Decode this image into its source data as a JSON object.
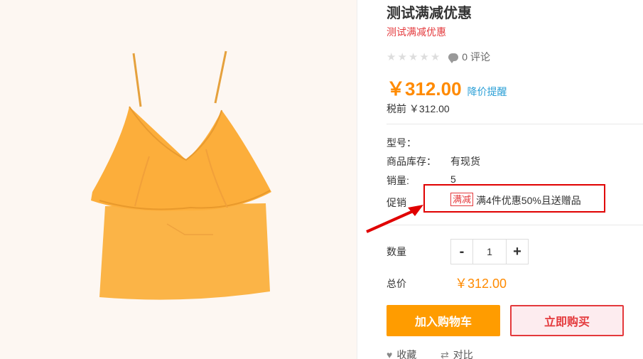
{
  "product": {
    "title": "测试满减优惠",
    "subtitle": "测试满减优惠",
    "rating_stars": 0,
    "comments_label": "0 评论",
    "price": "￥312.00",
    "price_alert": "降价提醒",
    "tax_label": "税前",
    "tax_price": "￥312.00"
  },
  "attributes": {
    "model_label": "型号：",
    "model_value": "",
    "stock_label": "商品库存：",
    "stock_value": "有现货",
    "sales_label": "销量:",
    "sales_value": "5",
    "promo_label": "促销",
    "promo_tag": "满减",
    "promo_text": "满4件优惠50%且送赠品"
  },
  "purchase": {
    "qty_label": "数量",
    "qty_minus": "-",
    "qty_value": "1",
    "qty_plus": "+",
    "total_label": "总价",
    "total_price": "￥312.00",
    "add_to_cart": "加入购物车",
    "buy_now": "立即购买"
  },
  "actions": {
    "favorite": "收藏",
    "compare": "对比"
  },
  "colors": {
    "price": "#ff8a00",
    "accent_red": "#e4393c",
    "cart_button": "#ff9c00",
    "highlight_box": "#e00000"
  },
  "icons": [
    "star-icon",
    "comment-icon",
    "heart-icon",
    "compare-icon",
    "annotation-arrow-icon"
  ]
}
